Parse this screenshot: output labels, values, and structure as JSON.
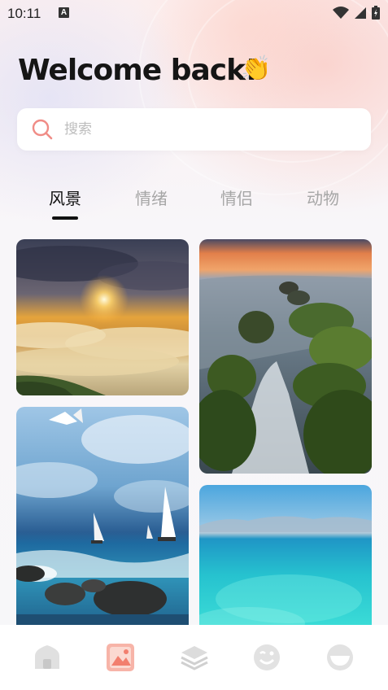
{
  "status_bar": {
    "time": "10:11",
    "notification_icon": "A"
  },
  "header": {
    "title": "Welcome back!",
    "emoji": "👏"
  },
  "search": {
    "placeholder": "搜索"
  },
  "tabs": [
    {
      "label": "风景",
      "active": true
    },
    {
      "label": "情绪",
      "active": false
    },
    {
      "label": "情侣",
      "active": false
    },
    {
      "label": "动物",
      "active": false
    }
  ],
  "gallery": {
    "items": [
      {
        "name": "sunset-above-clouds",
        "column": "left"
      },
      {
        "name": "seashore-rocks-waterfall",
        "column": "right"
      },
      {
        "name": "sailboats-seagulls-ocean",
        "column": "left"
      },
      {
        "name": "turquoise-sea",
        "column": "right"
      }
    ]
  },
  "bottom_nav": [
    {
      "icon": "home-icon",
      "active": false
    },
    {
      "icon": "gallery-icon",
      "active": true
    },
    {
      "icon": "layers-icon",
      "active": false
    },
    {
      "icon": "wink-face-icon",
      "active": false
    },
    {
      "icon": "smile-face-icon",
      "active": false
    }
  ],
  "colors": {
    "accent": "#f27f6e",
    "text": "#151515",
    "muted": "#a6a6a6"
  }
}
